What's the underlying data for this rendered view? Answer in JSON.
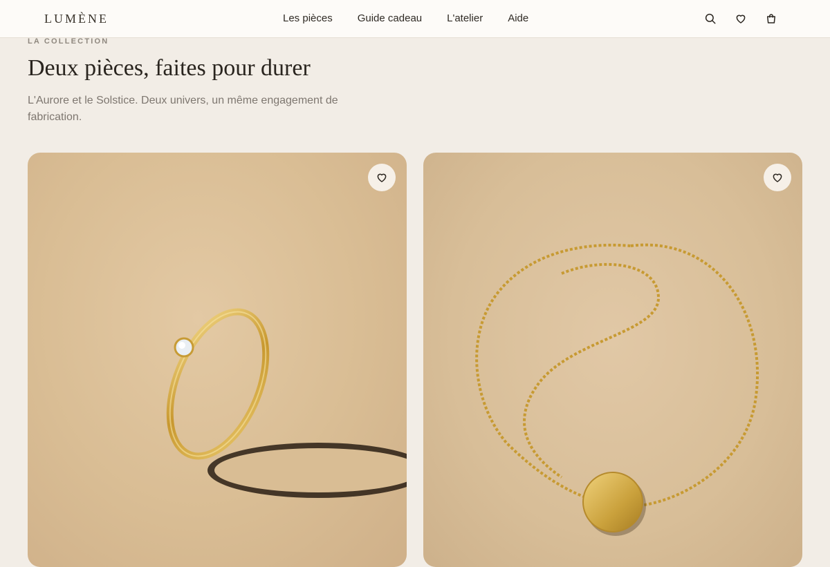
{
  "brand": {
    "logo": "LUMÈNE"
  },
  "nav": {
    "items": [
      {
        "label": "Les pièces"
      },
      {
        "label": "Guide cadeau"
      },
      {
        "label": "L'atelier"
      },
      {
        "label": "Aide"
      }
    ]
  },
  "header_icons": [
    "search-icon",
    "heart-icon",
    "bag-icon"
  ],
  "collection": {
    "eyebrow": "LA COLLECTION",
    "title": "Deux pièces, faites pour durer",
    "subtitle": "L'Aurore et le Solstice. Deux univers, un même engagement de fabrication."
  },
  "products": [
    {
      "image": "ring-photo"
    },
    {
      "image": "bracelet-photo"
    }
  ],
  "colors": {
    "background": "#f2ede6",
    "header": "#fdfbf8",
    "gold": "#c9a23a"
  }
}
